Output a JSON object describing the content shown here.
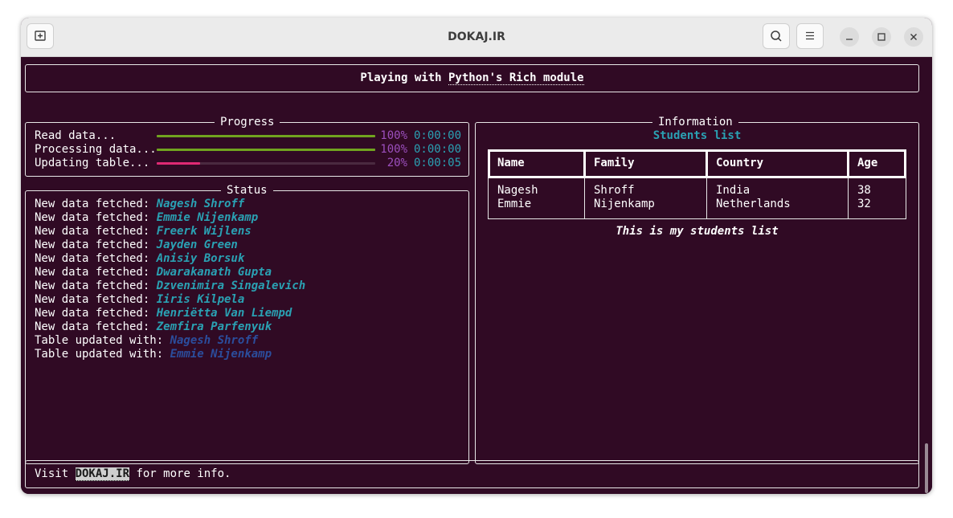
{
  "window": {
    "title": "DOKAJ.IR"
  },
  "header": {
    "prefix": "Playing with ",
    "link": "Python's Rich module"
  },
  "progress": {
    "title": "Progress",
    "tasks": [
      {
        "label": "Read data...",
        "percent": "100%",
        "elapsed": "0:00:00",
        "fraction": 1.0
      },
      {
        "label": "Processing data...",
        "percent": "100%",
        "elapsed": "0:00:00",
        "fraction": 1.0
      },
      {
        "label": "Updating table...",
        "percent": "20%",
        "elapsed": "0:00:05",
        "fraction": 0.2
      }
    ],
    "colors": {
      "done": "#71a31f",
      "active": "#e02a74",
      "track": "#4a2a40",
      "percent": "#9c4fbd",
      "time": "#2aa1b3"
    }
  },
  "status": {
    "title": "Status",
    "lines": [
      {
        "prefix": "New data fetched: ",
        "name": "Nagesh Shroff",
        "style": "fetched"
      },
      {
        "prefix": "New data fetched: ",
        "name": "Emmie Nijenkamp",
        "style": "fetched"
      },
      {
        "prefix": "New data fetched: ",
        "name": "Freerk Wijlens",
        "style": "fetched"
      },
      {
        "prefix": "New data fetched: ",
        "name": "Jayden Green",
        "style": "fetched"
      },
      {
        "prefix": "New data fetched: ",
        "name": "Anisiy Borsuk",
        "style": "fetched"
      },
      {
        "prefix": "New data fetched: ",
        "name": "Dwarakanath Gupta",
        "style": "fetched"
      },
      {
        "prefix": "New data fetched: ",
        "name": "Dzvenimira Singalevich",
        "style": "fetched"
      },
      {
        "prefix": "New data fetched: ",
        "name": "Iiris Kilpela",
        "style": "fetched"
      },
      {
        "prefix": "New data fetched: ",
        "name": "Henriëtta Van Liempd",
        "style": "fetched"
      },
      {
        "prefix": "New data fetched: ",
        "name": "Zemfira Parfenyuk",
        "style": "fetched"
      },
      {
        "prefix": "Table updated with: ",
        "name": "Nagesh Shroff",
        "style": "updated"
      },
      {
        "prefix": "Table updated with: ",
        "name": "Emmie Nijenkamp",
        "style": "updated"
      }
    ]
  },
  "information": {
    "title": "Information",
    "table_title": "Students list",
    "caption": "This is my students list",
    "columns": [
      "Name",
      "Family",
      "Country",
      "Age"
    ],
    "rows": [
      [
        "Nagesh",
        "Shroff",
        "India",
        "38"
      ],
      [
        "Emmie",
        "Nijenkamp",
        "Netherlands",
        "32"
      ]
    ]
  },
  "footer": {
    "prefix": "Visit ",
    "link": "DOKAJ.IR",
    "suffix": " for more info."
  }
}
